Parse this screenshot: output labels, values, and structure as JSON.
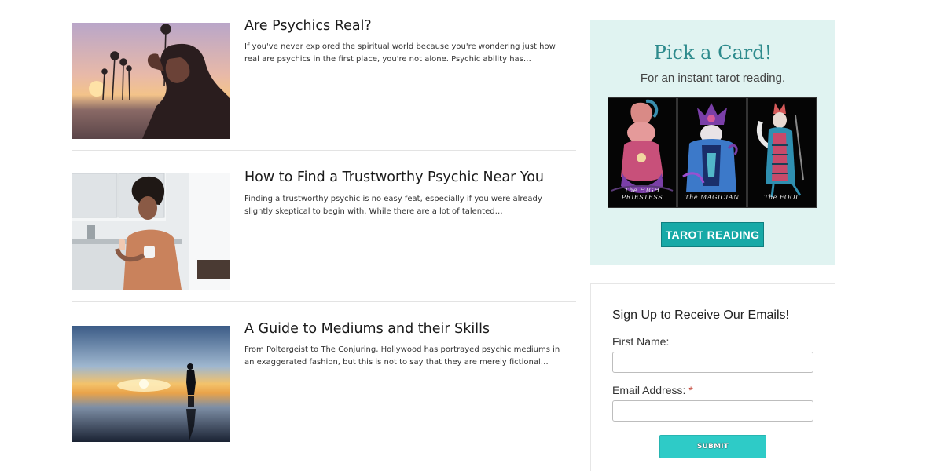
{
  "articles": [
    {
      "title": "Are Psychics Real?",
      "excerpt": "If you've never explored the spiritual world because you're wondering just how real are psychics in the first place, you're not alone. Psychic ability has…",
      "image": "woman-sunset-palms-photo"
    },
    {
      "title": "How to Find a Trustworthy Psychic Near You",
      "excerpt": "Finding a trustworthy psychic is no easy feat, especially if you were already slightly skeptical to begin with. While there are a lot of talented…",
      "image": "woman-phone-kitchen-photo"
    },
    {
      "title": "A Guide to Mediums and their Skills",
      "excerpt": "From Poltergeist to The Conjuring, Hollywood has portrayed psychic mediums in an exaggerated fashion, but this is not to say that they are merely fictional…",
      "image": "silhouette-sunset-reflection-photo"
    }
  ],
  "tarot": {
    "heading": "Pick a Card!",
    "subheading": "For an instant tarot reading.",
    "cards": [
      {
        "name": "The HIGH PRIESTESS"
      },
      {
        "name": "The MAGICIAN"
      },
      {
        "name": "The FOOL"
      }
    ],
    "button_label": "TAROT READING",
    "background": "#e0f3f1",
    "accent": "#17a9a7"
  },
  "signup": {
    "title": "Sign Up to Receive Our Emails!",
    "first_name_label": "First Name:",
    "email_label": "Email Address:",
    "required_marker": "*",
    "first_name_value": "",
    "email_value": "",
    "submit_label": "SUBMIT",
    "submit_color": "#2ecbc7"
  }
}
